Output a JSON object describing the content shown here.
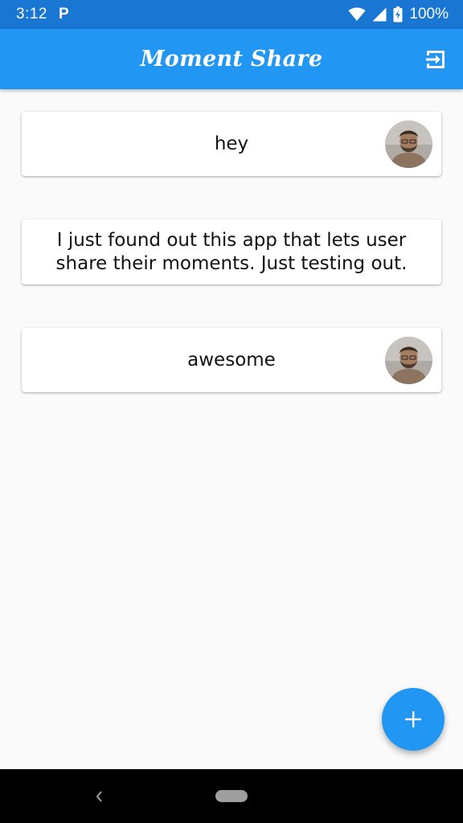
{
  "status_bar": {
    "time": "3:12",
    "notification_letter": "P",
    "battery": "100%",
    "icons": [
      "wifi-icon",
      "signal-icon",
      "battery-charging-icon"
    ]
  },
  "app_bar": {
    "title": "Moment Share",
    "action_icon": "logout-icon"
  },
  "posts": [
    {
      "text": "hey",
      "has_avatar": true
    },
    {
      "text": "I just found out this app that lets user share their moments. Just testing out.",
      "has_avatar": false
    },
    {
      "text": "awesome",
      "has_avatar": true
    }
  ],
  "fab": {
    "icon": "plus-icon"
  },
  "nav_bar": {
    "icons": [
      "back-icon",
      "home-pill-icon"
    ]
  },
  "colors": {
    "status_bar": "#1976d2",
    "app_bar": "#2196f3",
    "background": "#fafafa",
    "card": "#ffffff",
    "fab": "#2196f3"
  }
}
